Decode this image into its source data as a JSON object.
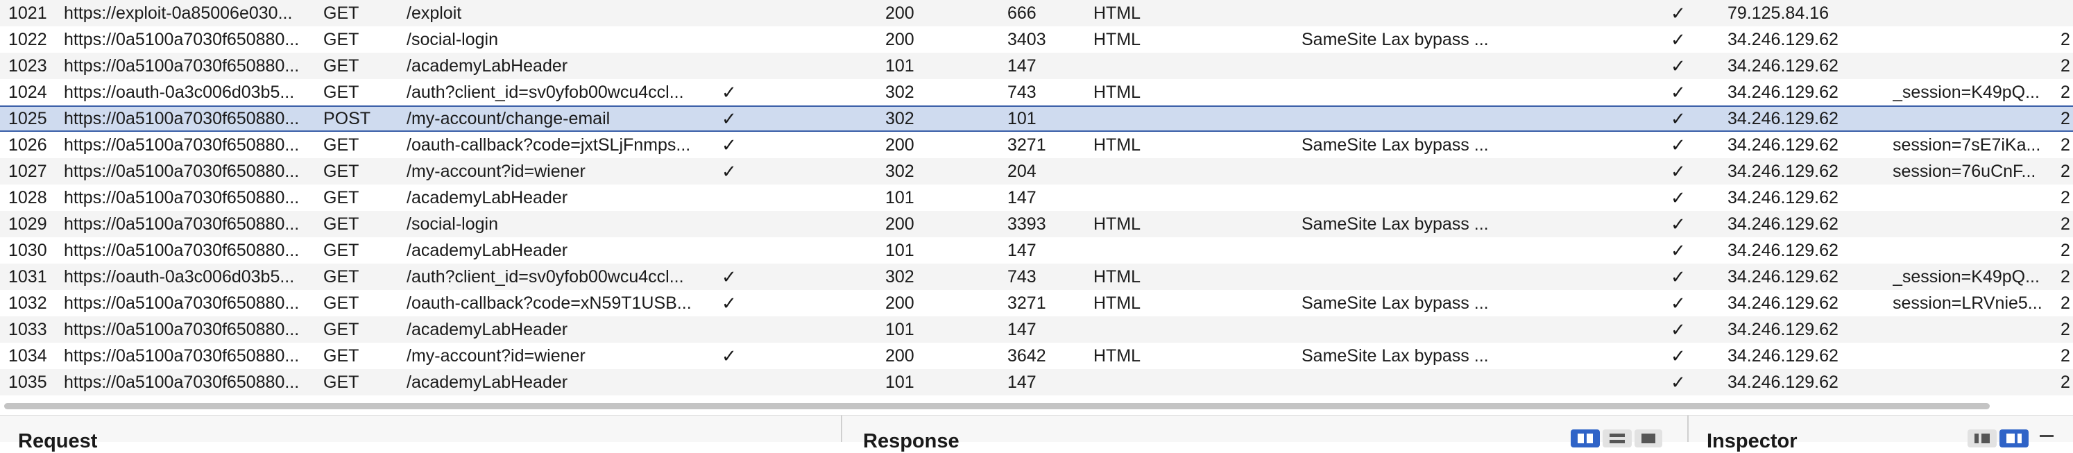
{
  "table": {
    "rows": [
      {
        "num": "1021",
        "host": "https://exploit-0a85006e030...",
        "method": "GET",
        "url": "/exploit",
        "params": "",
        "status": "200",
        "length": "666",
        "mime": "HTML",
        "title": "",
        "tls": "✓",
        "ip": "79.125.84.16",
        "cookies": "",
        "trunc": ""
      },
      {
        "num": "1022",
        "host": "https://0a5100a7030f650880...",
        "method": "GET",
        "url": "/social-login",
        "params": "",
        "status": "200",
        "length": "3403",
        "mime": "HTML",
        "title": "SameSite Lax bypass ...",
        "tls": "✓",
        "ip": "34.246.129.62",
        "cookies": "",
        "trunc": "2"
      },
      {
        "num": "1023",
        "host": "https://0a5100a7030f650880...",
        "method": "GET",
        "url": "/academyLabHeader",
        "params": "",
        "status": "101",
        "length": "147",
        "mime": "",
        "title": "",
        "tls": "✓",
        "ip": "34.246.129.62",
        "cookies": "",
        "trunc": "2"
      },
      {
        "num": "1024",
        "host": "https://oauth-0a3c006d03b5...",
        "method": "GET",
        "url": "/auth?client_id=sv0yfob00wcu4ccl...",
        "params": "✓",
        "status": "302",
        "length": "743",
        "mime": "HTML",
        "title": "",
        "tls": "✓",
        "ip": "34.246.129.62",
        "cookies": "_session=K49pQ...",
        "trunc": "2"
      },
      {
        "num": "1025",
        "host": "https://0a5100a7030f650880...",
        "method": "POST",
        "url": "/my-account/change-email",
        "params": "✓",
        "status": "302",
        "length": "101",
        "mime": "",
        "title": "",
        "tls": "✓",
        "ip": "34.246.129.62",
        "cookies": "",
        "trunc": "2",
        "selected": true
      },
      {
        "num": "1026",
        "host": "https://0a5100a7030f650880...",
        "method": "GET",
        "url": "/oauth-callback?code=jxtSLjFnmps...",
        "params": "✓",
        "status": "200",
        "length": "3271",
        "mime": "HTML",
        "title": "SameSite Lax bypass ...",
        "tls": "✓",
        "ip": "34.246.129.62",
        "cookies": "session=7sE7iKa...",
        "trunc": "2"
      },
      {
        "num": "1027",
        "host": "https://0a5100a7030f650880...",
        "method": "GET",
        "url": "/my-account?id=wiener",
        "params": "✓",
        "status": "302",
        "length": "204",
        "mime": "",
        "title": "",
        "tls": "✓",
        "ip": "34.246.129.62",
        "cookies": "session=76uCnF...",
        "trunc": "2"
      },
      {
        "num": "1028",
        "host": "https://0a5100a7030f650880...",
        "method": "GET",
        "url": "/academyLabHeader",
        "params": "",
        "status": "101",
        "length": "147",
        "mime": "",
        "title": "",
        "tls": "✓",
        "ip": "34.246.129.62",
        "cookies": "",
        "trunc": "2"
      },
      {
        "num": "1029",
        "host": "https://0a5100a7030f650880...",
        "method": "GET",
        "url": "/social-login",
        "params": "",
        "status": "200",
        "length": "3393",
        "mime": "HTML",
        "title": "SameSite Lax bypass ...",
        "tls": "✓",
        "ip": "34.246.129.62",
        "cookies": "",
        "trunc": "2"
      },
      {
        "num": "1030",
        "host": "https://0a5100a7030f650880...",
        "method": "GET",
        "url": "/academyLabHeader",
        "params": "",
        "status": "101",
        "length": "147",
        "mime": "",
        "title": "",
        "tls": "✓",
        "ip": "34.246.129.62",
        "cookies": "",
        "trunc": "2"
      },
      {
        "num": "1031",
        "host": "https://oauth-0a3c006d03b5...",
        "method": "GET",
        "url": "/auth?client_id=sv0yfob00wcu4ccl...",
        "params": "✓",
        "status": "302",
        "length": "743",
        "mime": "HTML",
        "title": "",
        "tls": "✓",
        "ip": "34.246.129.62",
        "cookies": "_session=K49pQ...",
        "trunc": "2"
      },
      {
        "num": "1032",
        "host": "https://0a5100a7030f650880...",
        "method": "GET",
        "url": "/oauth-callback?code=xN59T1USB...",
        "params": "✓",
        "status": "200",
        "length": "3271",
        "mime": "HTML",
        "title": "SameSite Lax bypass ...",
        "tls": "✓",
        "ip": "34.246.129.62",
        "cookies": "session=LRVnie5...",
        "trunc": "2"
      },
      {
        "num": "1033",
        "host": "https://0a5100a7030f650880...",
        "method": "GET",
        "url": "/academyLabHeader",
        "params": "",
        "status": "101",
        "length": "147",
        "mime": "",
        "title": "",
        "tls": "✓",
        "ip": "34.246.129.62",
        "cookies": "",
        "trunc": "2"
      },
      {
        "num": "1034",
        "host": "https://0a5100a7030f650880...",
        "method": "GET",
        "url": "/my-account?id=wiener",
        "params": "✓",
        "status": "200",
        "length": "3642",
        "mime": "HTML",
        "title": "SameSite Lax bypass ...",
        "tls": "✓",
        "ip": "34.246.129.62",
        "cookies": "",
        "trunc": "2"
      },
      {
        "num": "1035",
        "host": "https://0a5100a7030f650880...",
        "method": "GET",
        "url": "/academyLabHeader",
        "params": "",
        "status": "101",
        "length": "147",
        "mime": "",
        "title": "",
        "tls": "✓",
        "ip": "34.246.129.62",
        "cookies": "",
        "trunc": "2"
      }
    ]
  },
  "panels": {
    "request_title": "Request",
    "response_title": "Response",
    "inspector_title": "Inspector"
  },
  "colors": {
    "selection": "#cfdbef",
    "selection_border": "#3a5fa8",
    "active_view": "#2f63c7"
  }
}
